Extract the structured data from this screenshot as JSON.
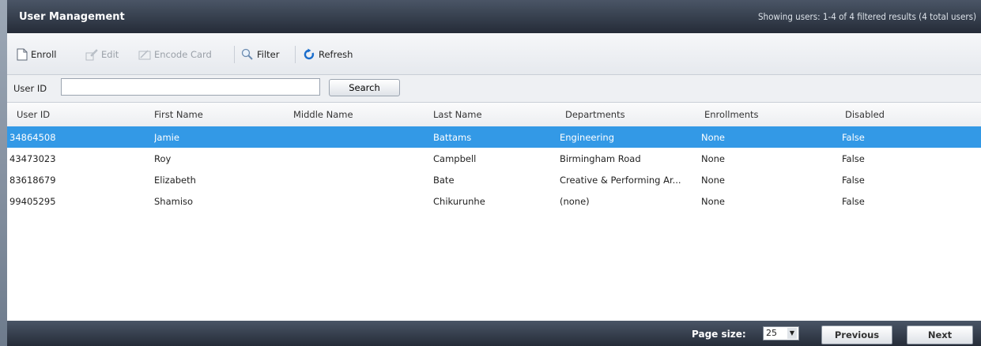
{
  "header": {
    "title": "User Management",
    "summary": "Showing users: 1-4 of 4 filtered results (4 total users)"
  },
  "toolbar": {
    "enroll": {
      "label": "Enroll",
      "icon": "document-icon",
      "enabled": true
    },
    "edit": {
      "label": "Edit",
      "icon": "edit-icon",
      "enabled": false
    },
    "encode_card": {
      "label": "Encode Card",
      "icon": "card-icon",
      "enabled": false
    },
    "filter": {
      "label": "Filter",
      "icon": "magnifier-icon",
      "enabled": true
    },
    "refresh": {
      "label": "Refresh",
      "icon": "refresh-icon",
      "enabled": true
    }
  },
  "search": {
    "label": "User ID",
    "value": "",
    "button": "Search"
  },
  "table": {
    "columns": [
      "User ID",
      "First Name",
      "Middle Name",
      "Last Name",
      "Departments",
      "Enrollments",
      "Disabled"
    ],
    "rows": [
      [
        "34864508",
        "Jamie",
        "",
        "Battams",
        "Engineering",
        "None",
        "False"
      ],
      [
        "43473023",
        "Roy",
        "",
        "Campbell",
        "Birmingham Road",
        "None",
        "False"
      ],
      [
        "83618679",
        "Elizabeth",
        "",
        "Bate",
        "Creative & Performing Ar...",
        "None",
        "False"
      ],
      [
        "99405295",
        "Shamiso",
        "",
        "Chikurunhe",
        "(none)",
        "None",
        "False"
      ]
    ],
    "selected_row": 0
  },
  "footer": {
    "page_size_label": "Page size:",
    "page_size": "25",
    "previous": "Previous",
    "next": "Next"
  },
  "colors": {
    "selection": "#3399e6",
    "header_dark": "#252c38"
  }
}
